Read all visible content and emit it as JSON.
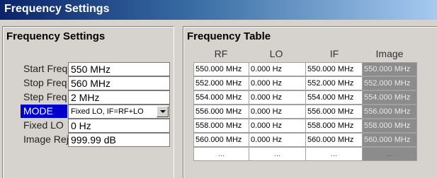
{
  "window": {
    "title": "Frequency Settings"
  },
  "settings": {
    "title": "Frequency Settings",
    "rows": [
      {
        "label": "Start Freq",
        "value": "550 MHz"
      },
      {
        "label": "Stop Freq",
        "value": "560 MHz"
      },
      {
        "label": "Step Freq",
        "value": "2 MHz"
      },
      {
        "label": "MODE",
        "value": "Fixed LO, IF=RF+LO",
        "selected": true
      },
      {
        "label": "Fixed LO",
        "value": "0 Hz"
      },
      {
        "label": "Image Rej",
        "value": "999.99 dB"
      }
    ]
  },
  "table": {
    "title": "Frequency Table",
    "headers": [
      "RF",
      "LO",
      "IF",
      "Image"
    ],
    "rows": [
      [
        "550.000 MHz",
        "0.000 Hz",
        "550.000 MHz",
        "550.000 MHz"
      ],
      [
        "552.000 MHz",
        "0.000 Hz",
        "552.000 MHz",
        "552.000 MHz"
      ],
      [
        "554.000 MHz",
        "0.000 Hz",
        "554.000 MHz",
        "554.000 MHz"
      ],
      [
        "556.000 MHz",
        "0.000 Hz",
        "556.000 MHz",
        "556.000 MHz"
      ],
      [
        "558.000 MHz",
        "0.000 Hz",
        "558.000 MHz",
        "558.000 MHz"
      ],
      [
        "560.000 MHz",
        "0.000 Hz",
        "560.000 MHz",
        "560.000 MHz"
      ],
      [
        "...",
        "...",
        "...",
        "..."
      ]
    ]
  },
  "colors": {
    "title_gradient_start": "#0a246a",
    "title_gradient_end": "#a6caf0",
    "selected_label_bg": "#0000cc",
    "image_column_bg": "#8c8c8c"
  },
  "icons": {
    "dropdown": "chevron-down-icon"
  }
}
